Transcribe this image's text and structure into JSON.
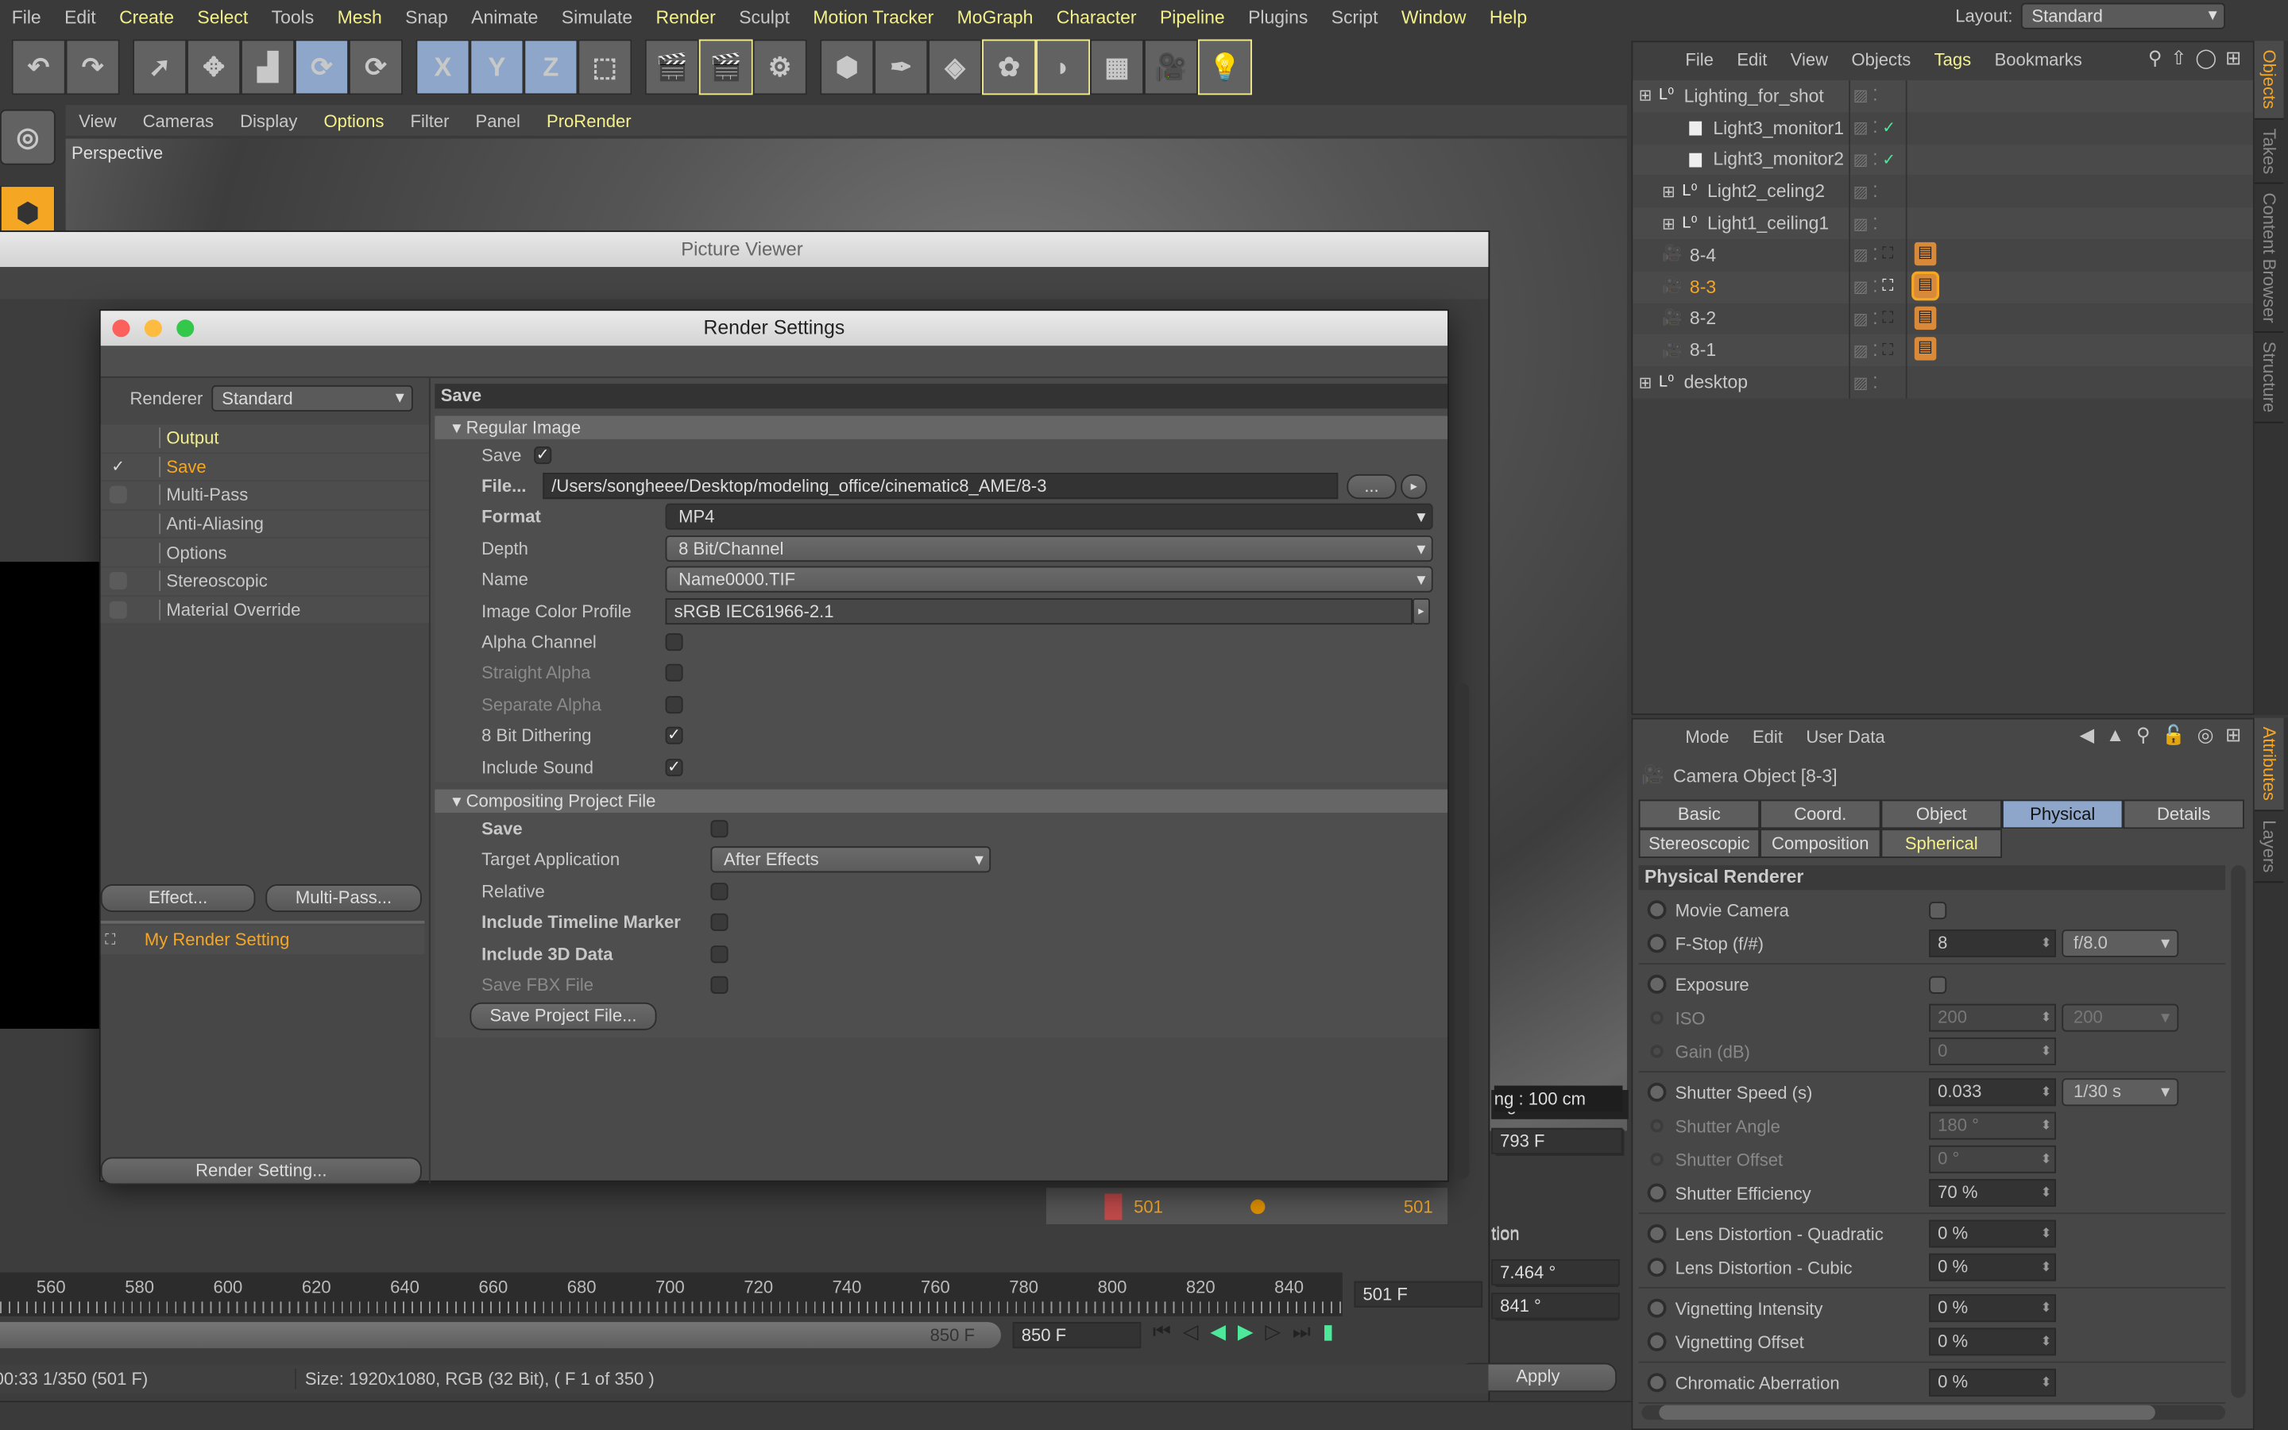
{
  "menu": {
    "items": [
      {
        "label": "File",
        "hl": false
      },
      {
        "label": "Edit",
        "hl": false
      },
      {
        "label": "Create",
        "hl": true
      },
      {
        "label": "Select",
        "hl": true
      },
      {
        "label": "Tools",
        "hl": false
      },
      {
        "label": "Mesh",
        "hl": true
      },
      {
        "label": "Snap",
        "hl": false
      },
      {
        "label": "Animate",
        "hl": false
      },
      {
        "label": "Simulate",
        "hl": false
      },
      {
        "label": "Render",
        "hl": true
      },
      {
        "label": "Sculpt",
        "hl": false
      },
      {
        "label": "Motion Tracker",
        "hl": true
      },
      {
        "label": "MoGraph",
        "hl": true
      },
      {
        "label": "Character",
        "hl": true
      },
      {
        "label": "Pipeline",
        "hl": true
      },
      {
        "label": "Plugins",
        "hl": false
      },
      {
        "label": "Script",
        "hl": false
      },
      {
        "label": "Window",
        "hl": true
      },
      {
        "label": "Help",
        "hl": true
      }
    ],
    "layout_label": "Layout:",
    "layout_value": "Standard"
  },
  "toolbar": {
    "groups": [
      [
        {
          "icon": "undo-icon",
          "g": "↶"
        },
        {
          "icon": "redo-icon",
          "g": "↷"
        }
      ],
      [
        {
          "icon": "live-select-icon",
          "g": "➚"
        },
        {
          "icon": "move-icon",
          "g": "✥"
        },
        {
          "icon": "scale-icon",
          "g": "▟"
        },
        {
          "icon": "rotate-icon",
          "g": "⟳",
          "sel": true
        },
        {
          "icon": "recent-tools-icon",
          "g": "⟳"
        }
      ],
      [
        {
          "icon": "x-axis-icon",
          "g": "X",
          "sel": true
        },
        {
          "icon": "y-axis-icon",
          "g": "Y",
          "sel": true
        },
        {
          "icon": "z-axis-icon",
          "g": "Z",
          "sel": true
        },
        {
          "icon": "coordinate-system-icon",
          "g": "⬚"
        }
      ],
      [
        {
          "icon": "render-view-icon",
          "g": "🎬"
        },
        {
          "icon": "render-picture-viewer-icon",
          "g": "🎬",
          "hl": true
        },
        {
          "icon": "edit-render-settings-icon",
          "g": "⚙"
        }
      ],
      [
        {
          "icon": "cube-icon",
          "g": "⬢"
        },
        {
          "icon": "pen-icon",
          "g": "✒"
        },
        {
          "icon": "subdivision-icon",
          "g": "◈"
        },
        {
          "icon": "cloner-icon",
          "g": "✿",
          "hl": true
        },
        {
          "icon": "deformer-icon",
          "g": "◗",
          "hl": true
        },
        {
          "icon": "floor-icon",
          "g": "▦"
        },
        {
          "icon": "camera-icon",
          "g": "🎥"
        },
        {
          "icon": "light-icon",
          "g": "💡",
          "hl": true
        }
      ]
    ]
  },
  "viewport": {
    "menu": [
      {
        "label": "View",
        "hl": false
      },
      {
        "label": "Cameras",
        "hl": false
      },
      {
        "label": "Display",
        "hl": false
      },
      {
        "label": "Options",
        "hl": true
      },
      {
        "label": "Filter",
        "hl": false
      },
      {
        "label": "Panel",
        "hl": false
      },
      {
        "label": "ProRender",
        "hl": true
      }
    ],
    "label": "Perspective"
  },
  "picture_viewer": {
    "title": "Picture Viewer",
    "status_time": "00:33 1/350 (501 F)",
    "status_size": "Size: 1920x1080, RGB (32 Bit), ( F 1 of 350 )",
    "ticks": [
      "560",
      "580",
      "600",
      "620",
      "640",
      "660",
      "680",
      "700",
      "720",
      "740",
      "760",
      "780",
      "800",
      "820",
      "840"
    ],
    "current_frame": "501 F",
    "end_frame": "850 F",
    "slider_end": "850 F",
    "list_row": {
      "start": "501",
      "end": "501"
    },
    "overlay": "ng : 100 cm",
    "frame_field": "793 F",
    "section_label": "tion",
    "value1": "7.464 °",
    "value2": "841 °",
    "apply": "Apply"
  },
  "render_settings": {
    "title": "Render Settings",
    "renderer_label": "Renderer",
    "renderer_value": "Standard",
    "nav": [
      {
        "label": "Output",
        "check": "none",
        "color": "y"
      },
      {
        "label": "Save",
        "check": "checked",
        "color": "o"
      },
      {
        "label": "Multi-Pass",
        "check": "box",
        "color": ""
      },
      {
        "label": "Anti-Aliasing",
        "check": "none",
        "color": ""
      },
      {
        "label": "Options",
        "check": "none",
        "color": ""
      },
      {
        "label": "Stereoscopic",
        "check": "box",
        "color": ""
      },
      {
        "label": "Material Override",
        "check": "box",
        "color": ""
      }
    ],
    "effect_btn": "Effect...",
    "multipass_btn": "Multi-Pass...",
    "setting_name": "My Render Setting",
    "render_setting_btn": "Render Setting...",
    "section": "Save",
    "regular_image": {
      "title": "Regular Image",
      "save_label": "Save",
      "save_checked": true,
      "file_label": "File...",
      "file_path": "/Users/songheee/Desktop/modeling_office/cinematic8_AME/8-3",
      "browse": "...",
      "format_label": "Format",
      "format_value": "MP4",
      "depth_label": "Depth",
      "depth_value": "8 Bit/Channel",
      "name_label": "Name",
      "name_value": "Name0000.TIF",
      "profile_label": "Image Color Profile",
      "profile_value": "sRGB IEC61966-2.1",
      "checks": [
        {
          "label": "Alpha Channel",
          "checked": false,
          "dim": false
        },
        {
          "label": "Straight Alpha",
          "checked": false,
          "dim": true
        },
        {
          "label": "Separate Alpha",
          "checked": false,
          "dim": true
        },
        {
          "label": "8 Bit Dithering",
          "checked": true,
          "dim": false
        },
        {
          "label": "Include Sound",
          "checked": true,
          "dim": false
        }
      ]
    },
    "compositing": {
      "title": "Compositing Project File",
      "save_label": "Save",
      "target_label": "Target Application",
      "target_value": "After Effects",
      "checks": [
        {
          "label": "Relative",
          "bold": false,
          "dim": false
        },
        {
          "label": "Include Timeline Marker",
          "bold": true,
          "dim": false
        },
        {
          "label": "Include 3D Data",
          "bold": true,
          "dim": false
        },
        {
          "label": "Save FBX File",
          "bold": false,
          "dim": true
        }
      ],
      "save_project_btn": "Save Project File..."
    }
  },
  "object_manager": {
    "menu": [
      {
        "label": "File",
        "hl": false
      },
      {
        "label": "Edit",
        "hl": false
      },
      {
        "label": "View",
        "hl": false
      },
      {
        "label": "Objects",
        "hl": false
      },
      {
        "label": "Tags",
        "hl": true
      },
      {
        "label": "Bookmarks",
        "hl": false
      }
    ],
    "tree": [
      {
        "name": "Lighting_for_shot",
        "icon": "null-object-icon",
        "depth": 0,
        "expander": "−",
        "check": false,
        "tag": false,
        "sel": false
      },
      {
        "name": "Light3_monitor1",
        "icon": "area-light-icon",
        "depth": 1,
        "expander": "",
        "check": true,
        "tag": false,
        "sel": false
      },
      {
        "name": "Light3_monitor2",
        "icon": "area-light-icon",
        "depth": 1,
        "expander": "",
        "check": true,
        "tag": false,
        "sel": false
      },
      {
        "name": "Light2_celing2",
        "icon": "null-object-icon",
        "depth": 1,
        "expander": "+",
        "check": false,
        "tag": false,
        "sel": false
      },
      {
        "name": "Light1_ceiling1",
        "icon": "null-object-icon",
        "depth": 1,
        "expander": "+",
        "check": false,
        "tag": false,
        "sel": false
      },
      {
        "name": "8-4",
        "icon": "camera-icon",
        "depth": 0,
        "expander": "",
        "check": false,
        "tag": true,
        "sel": false
      },
      {
        "name": "8-3",
        "icon": "camera-icon",
        "depth": 0,
        "expander": "",
        "check": false,
        "tag": true,
        "sel": true
      },
      {
        "name": "8-2",
        "icon": "camera-icon",
        "depth": 0,
        "expander": "",
        "check": false,
        "tag": true,
        "sel": false
      },
      {
        "name": "8-1",
        "icon": "camera-icon",
        "depth": 0,
        "expander": "",
        "check": false,
        "tag": true,
        "sel": false
      },
      {
        "name": "desktop",
        "icon": "null-object-icon",
        "depth": 0,
        "expander": "+",
        "check": false,
        "tag": false,
        "sel": false
      }
    ],
    "side_tabs": [
      {
        "label": "Objects",
        "active": true
      },
      {
        "label": "Takes",
        "active": false
      },
      {
        "label": "Content Browser",
        "active": false
      },
      {
        "label": "Structure",
        "active": false
      }
    ]
  },
  "attributes": {
    "menu": [
      {
        "label": "Mode"
      },
      {
        "label": "Edit"
      },
      {
        "label": "User Data"
      }
    ],
    "object_title": "Camera Object [8-3]",
    "tabs": [
      {
        "label": "Basic",
        "state": ""
      },
      {
        "label": "Coord.",
        "state": ""
      },
      {
        "label": "Object",
        "state": ""
      },
      {
        "label": "Physical",
        "state": "active"
      },
      {
        "label": "Details",
        "state": ""
      },
      {
        "label": "Stereoscopic",
        "state": ""
      },
      {
        "label": "Composition",
        "state": ""
      },
      {
        "label": "Spherical",
        "state": "hl"
      }
    ],
    "section": "Physical Renderer",
    "groups": [
      [
        {
          "label": "Movie Camera",
          "type": "check",
          "dim": false
        },
        {
          "label": "F-Stop (f/#)",
          "value": "8",
          "dropdown": "f/8.0",
          "dim": false
        }
      ],
      [
        {
          "label": "Exposure",
          "type": "check",
          "dim": false
        },
        {
          "label": "ISO",
          "value": "200",
          "dropdown": "200",
          "dim": true
        },
        {
          "label": "Gain (dB)",
          "value": "0",
          "dim": true
        }
      ],
      [
        {
          "label": "Shutter Speed (s)",
          "value": "0.033",
          "dropdown": "1/30 s",
          "dim": false
        },
        {
          "label": "Shutter Angle",
          "value": "180 °",
          "dim": true
        },
        {
          "label": "Shutter Offset",
          "value": "0 °",
          "dim": true
        },
        {
          "label": "Shutter Efficiency",
          "value": "70 %",
          "dim": false
        }
      ],
      [
        {
          "label": "Lens Distortion - Quadratic",
          "value": "0 %",
          "dim": false
        },
        {
          "label": "Lens Distortion - Cubic",
          "value": "0 %",
          "dim": false
        }
      ],
      [
        {
          "label": "Vignetting Intensity",
          "value": "0 %",
          "dim": false
        },
        {
          "label": "Vignetting Offset",
          "value": "0 %",
          "dim": false
        }
      ],
      [
        {
          "label": "Chromatic Aberration",
          "value": "0 %",
          "dim": false
        }
      ]
    ],
    "side_tabs": [
      {
        "label": "Attributes",
        "active": true
      },
      {
        "label": "Layers",
        "active": false
      }
    ]
  },
  "colors": {
    "accent_yellow": "#f3f08c",
    "accent_orange": "#f5a623",
    "selected_blue": "#8da6c9",
    "play_green": "#4de89a"
  }
}
